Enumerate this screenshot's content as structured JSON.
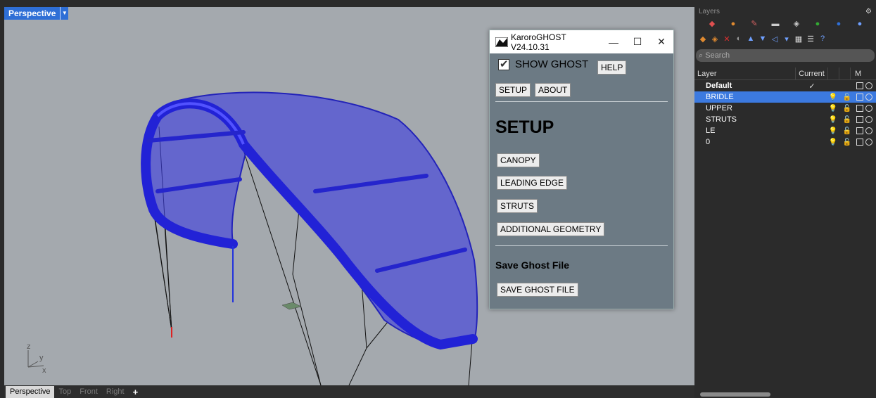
{
  "viewport": {
    "title": "Perspective",
    "axes": {
      "z": "z",
      "y": "y",
      "x": "x"
    }
  },
  "tabs": [
    "Perspective",
    "Top",
    "Front",
    "Right",
    "+"
  ],
  "dialog": {
    "title": "KaroroGHOST V24.10.31",
    "window_buttons": {
      "minimize": "—",
      "maximize": "☐",
      "close": "✕"
    },
    "show_ghost_label": "SHOW GHOST",
    "show_ghost_checked": true,
    "help_label": "HELP",
    "setup_label": "SETUP",
    "about_label": "ABOUT",
    "section_title": "SETUP",
    "canopy_label": "CANOPY",
    "leading_edge_label": "LEADING EDGE",
    "struts_label": "STRUTS",
    "additional_geometry_label": "ADDITIONAL GEOMETRY",
    "save_heading": "Save Ghost File",
    "save_button_label": "SAVE GHOST FILE"
  },
  "layers_panel": {
    "title": "Layers",
    "search_placeholder": "Search",
    "columns": {
      "layer": "Layer",
      "current": "Current",
      "m": "M"
    },
    "rows": [
      {
        "name": "Default",
        "current": "✓",
        "bold": true,
        "selected": false,
        "bulb": false
      },
      {
        "name": "BRIDLE",
        "current": "",
        "bold": false,
        "selected": true,
        "bulb": true
      },
      {
        "name": "UPPER",
        "current": "",
        "bold": false,
        "selected": false,
        "bulb": true
      },
      {
        "name": "STRUTS",
        "current": "",
        "bold": false,
        "selected": false,
        "bulb": true
      },
      {
        "name": "LE",
        "current": "",
        "bold": false,
        "selected": false,
        "bulb": true
      },
      {
        "name": "0",
        "current": "",
        "bold": false,
        "selected": false,
        "bulb": true
      }
    ]
  },
  "colors": {
    "viewport_bg": "#a4a9ae",
    "kite": "#2a2ad8",
    "accent": "#2f6fd6",
    "dialog_bg": "#6c7a84",
    "selected_row": "#3c7ae0"
  }
}
